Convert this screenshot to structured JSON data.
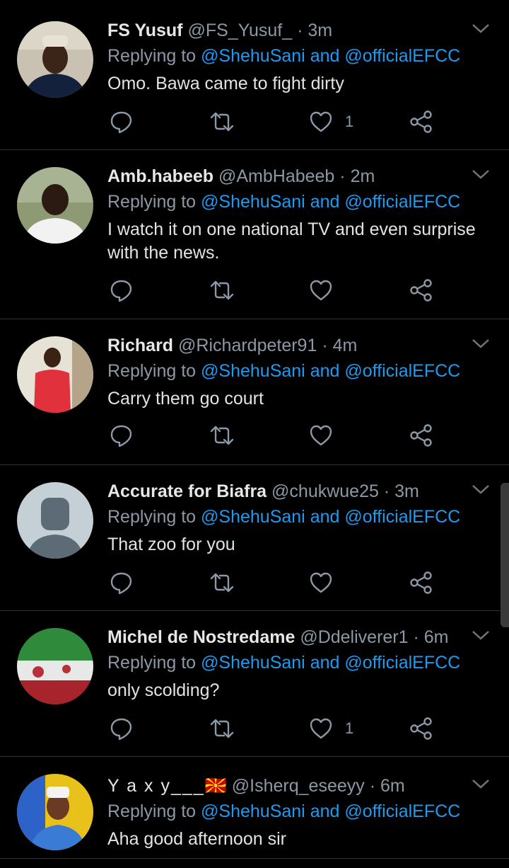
{
  "reply_prefix": "Replying to",
  "reply_and": "and",
  "reply_mention_1": "@ShehuSani",
  "reply_mention_2": "@officialEFCC",
  "colors": {
    "background": "#000000",
    "accent": "#1d9bf0",
    "muted": "#8b98a5",
    "text": "#e3e3e3"
  },
  "tweets": [
    {
      "name": "FS Yusuf",
      "handle": "@FS_Yusuf_",
      "time": "3m",
      "text": "Omo. Bawa came to fight dirty",
      "likes": "1",
      "avatar_icon": "profile-photo"
    },
    {
      "name": "Amb.habeeb",
      "handle": "@AmbHabeeb",
      "time": "2m",
      "text": "I watch it on one national TV and even surprise with the news.",
      "likes": "",
      "avatar_icon": "profile-photo"
    },
    {
      "name": "Richard",
      "handle": "@Richardpeter91",
      "time": "4m",
      "text": "Carry them go court",
      "likes": "",
      "avatar_icon": "profile-photo"
    },
    {
      "name": "Accurate for Biafra",
      "handle": "@chukwue25",
      "time": "3m",
      "text": "That zoo for you",
      "likes": "",
      "avatar_icon": "default-avatar"
    },
    {
      "name": "Michel de Nostredame",
      "handle": "@Ddeliverer1",
      "time": "6m",
      "text": "only scolding?",
      "likes": "1",
      "avatar_icon": "flag-photo"
    },
    {
      "name": "Y a x y___",
      "name_emoji": "🇲🇰",
      "handle": "@Isherq_eseeyy",
      "time": "6m",
      "text": "Aha good afternoon sir",
      "likes": "",
      "avatar_icon": "profile-photo"
    }
  ]
}
